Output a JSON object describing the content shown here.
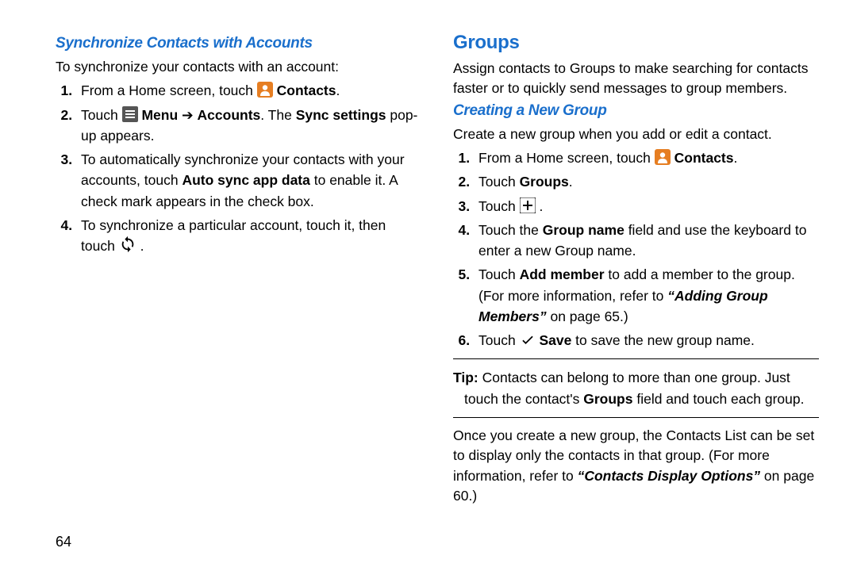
{
  "page_number": "64",
  "left": {
    "heading": "Synchronize Contacts with Accounts",
    "intro": "To synchronize your contacts with an account:",
    "items": {
      "i1_a": "From a Home screen, touch ",
      "i1_b": "Contacts",
      "i1_c": ".",
      "i2_a": "Touch ",
      "i2_b": "Menu",
      "i2_arrow": "  ➔  ",
      "i2_c": "Accounts",
      "i2_d": ". The ",
      "i2_e": "Sync settings",
      "i2_f": " pop-up appears.",
      "i3_a": "To automatically synchronize your contacts with your accounts, touch ",
      "i3_b": "Auto sync app data",
      "i3_c": " to enable it. A check mark appears in the check box.",
      "i4_a": "To synchronize a particular account, touch it, then touch ",
      "i4_b": "."
    }
  },
  "right": {
    "heading_main": "Groups",
    "intro_main": "Assign contacts to Groups to make searching for contacts faster or to quickly send messages to group members.",
    "heading_sub": "Creating a New Group",
    "intro_sub": "Create a new group when you add or edit a contact.",
    "items": {
      "i1_a": "From a Home screen, touch ",
      "i1_b": "Contacts",
      "i1_c": ".",
      "i2_a": "Touch ",
      "i2_b": "Groups",
      "i2_c": ".",
      "i3_a": "Touch ",
      "i3_b": ".",
      "i4_a": "Touch the ",
      "i4_b": "Group name",
      "i4_c": " field and use the keyboard to enter a new Group name.",
      "i5_a": "Touch ",
      "i5_b": "Add member",
      "i5_c": " to add a member to the group. (For more information, refer to ",
      "i5_d": "“Adding Group Members”",
      "i5_e": " on page 65.)",
      "i6_a": "Touch ",
      "i6_b": "Save",
      "i6_c": " to save the new group name."
    },
    "tip_label": "Tip:",
    "tip_text": " Contacts can belong to more than one group. Just touch the contact's ",
    "tip_bold": "Groups",
    "tip_text2": " field and touch each group.",
    "para2_a": "Once you create a new group, the Contacts List can be set to display only the contacts in that group. (For more information, refer to ",
    "para2_b": "“Contacts Display Options”",
    "para2_c": "  on page 60.)"
  }
}
